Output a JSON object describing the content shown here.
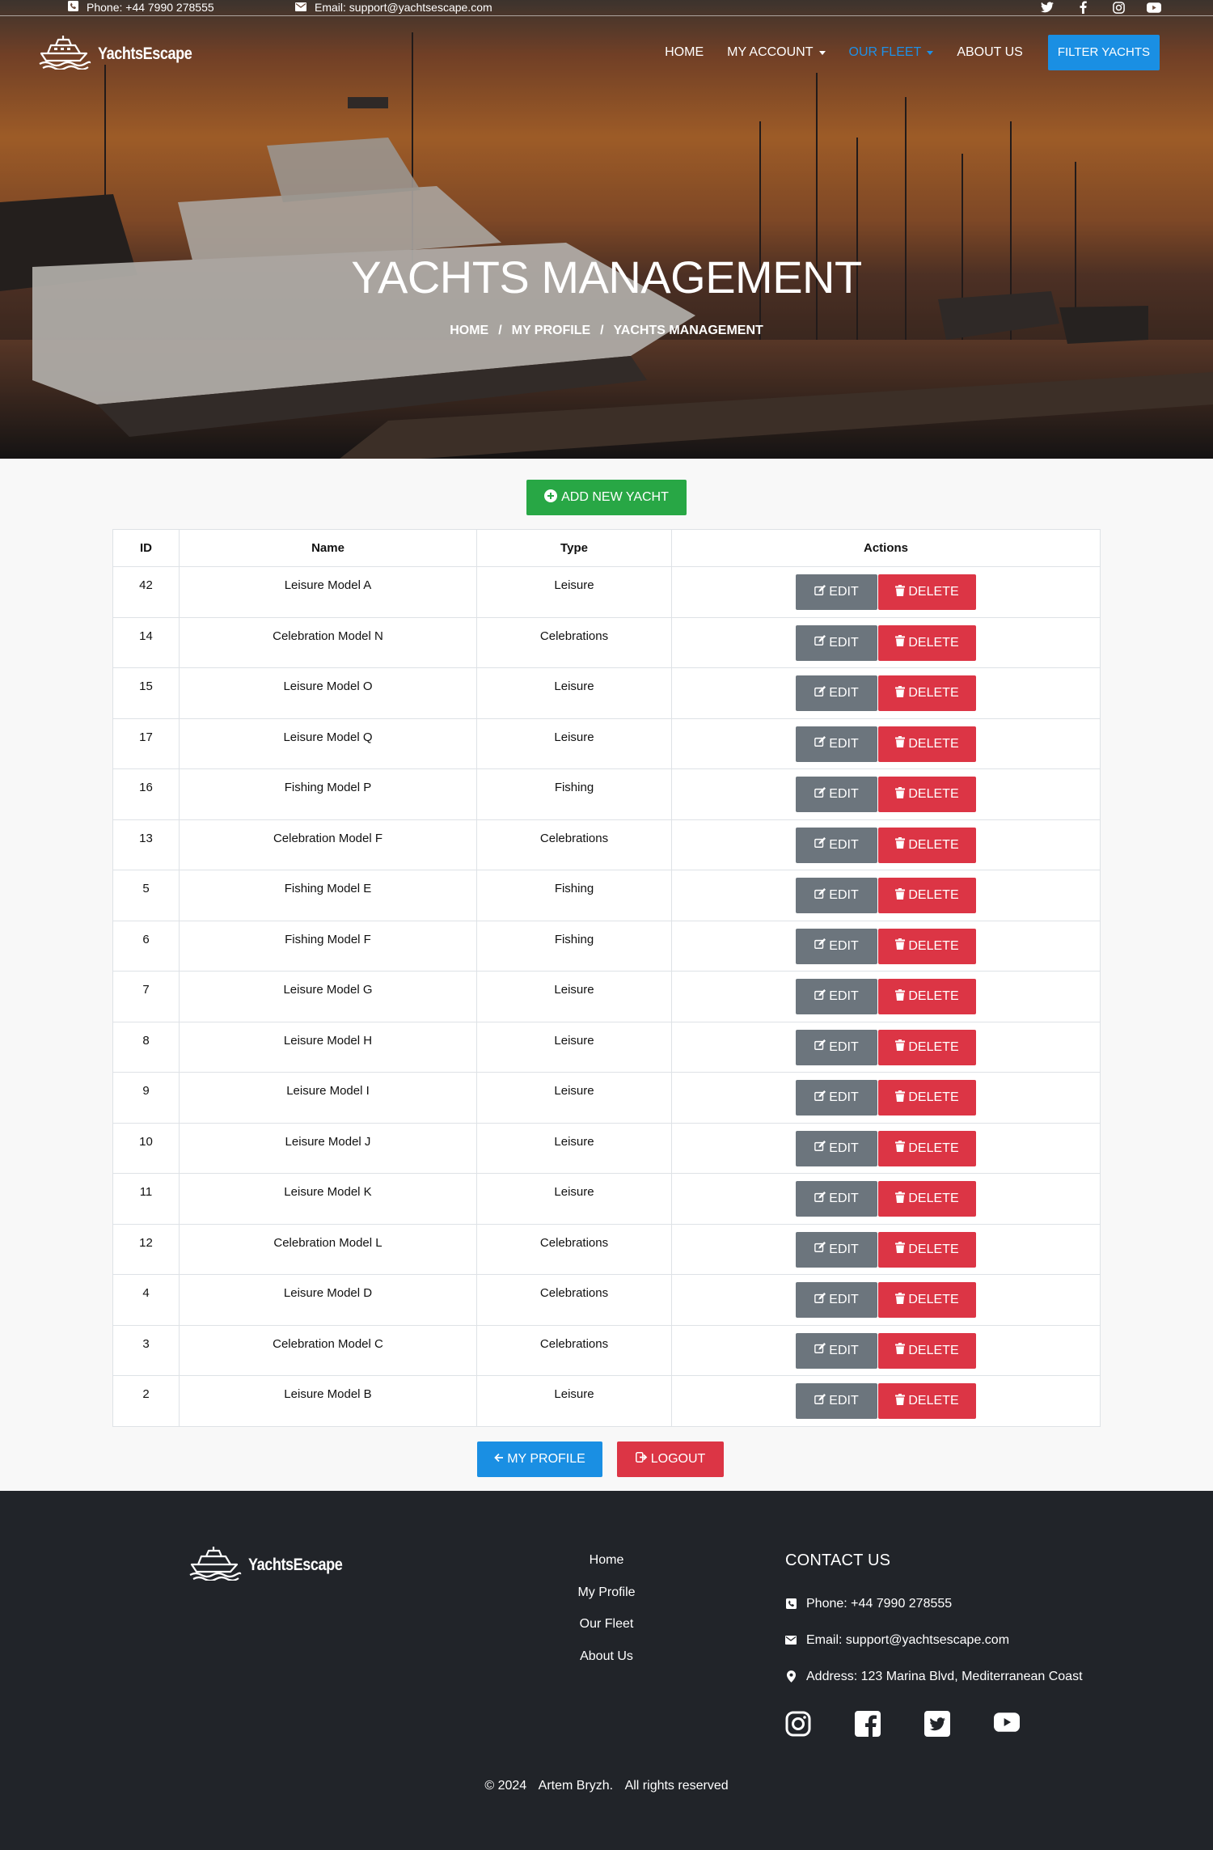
{
  "topbar": {
    "phone": "Phone: +44 7990 278555",
    "email": "Email: support@yachtsescape.com",
    "social_icons": [
      "twitter-icon",
      "facebook-icon",
      "instagram-icon",
      "youtube-icon"
    ]
  },
  "brand": {
    "name": "YachtsEscape"
  },
  "nav": {
    "home": "HOME",
    "my_account": "MY ACCOUNT",
    "our_fleet": "OUR FLEET",
    "about_us": "ABOUT US",
    "filter_yachts": "FILTER YACHTS"
  },
  "hero": {
    "title": "YACHTS MANAGEMENT",
    "breadcrumb": [
      "HOME",
      "MY PROFILE",
      "YACHTS MANAGEMENT"
    ],
    "separator": "/"
  },
  "main": {
    "add_button": "ADD NEW YACHT",
    "table": {
      "headers": [
        "ID",
        "Name",
        "Type",
        "Actions"
      ],
      "edit_label": "EDIT",
      "delete_label": "DELETE",
      "rows": [
        {
          "id": "42",
          "name": "Leisure Model A",
          "type": "Leisure"
        },
        {
          "id": "14",
          "name": "Celebration Model N",
          "type": "Celebrations"
        },
        {
          "id": "15",
          "name": "Leisure Model O",
          "type": "Leisure"
        },
        {
          "id": "17",
          "name": "Leisure Model Q",
          "type": "Leisure"
        },
        {
          "id": "16",
          "name": "Fishing Model P",
          "type": "Fishing"
        },
        {
          "id": "13",
          "name": "Celebration Model F",
          "type": "Celebrations"
        },
        {
          "id": "5",
          "name": "Fishing Model E",
          "type": "Fishing"
        },
        {
          "id": "6",
          "name": "Fishing Model F",
          "type": "Fishing"
        },
        {
          "id": "7",
          "name": "Leisure Model G",
          "type": "Leisure"
        },
        {
          "id": "8",
          "name": "Leisure Model H",
          "type": "Leisure"
        },
        {
          "id": "9",
          "name": "Leisure Model I",
          "type": "Leisure"
        },
        {
          "id": "10",
          "name": "Leisure Model J",
          "type": "Leisure"
        },
        {
          "id": "11",
          "name": "Leisure Model K",
          "type": "Leisure"
        },
        {
          "id": "12",
          "name": "Celebration Model L",
          "type": "Celebrations"
        },
        {
          "id": "4",
          "name": "Leisure Model D",
          "type": "Celebrations"
        },
        {
          "id": "3",
          "name": "Celebration Model C",
          "type": "Celebrations"
        },
        {
          "id": "2",
          "name": "Leisure Model B",
          "type": "Leisure"
        }
      ]
    },
    "my_profile_button": "MY PROFILE",
    "logout_button": "LOGOUT"
  },
  "footer": {
    "links": [
      "Home",
      "My Profile",
      "Our Fleet",
      "About Us"
    ],
    "contact_title": "CONTACT US",
    "phone": "Phone: +44 7990 278555",
    "email": "Email: support@yachtsescape.com",
    "address": "Address: 123 Marina Blvd, Mediterranean Coast",
    "social_icons": [
      "instagram-icon",
      "facebook-icon",
      "twitter-icon",
      "youtube-icon"
    ],
    "copyright": [
      "© 2024",
      "Artem Bryzh.",
      "All rights reserved"
    ]
  },
  "colors": {
    "primary": "#1a8fe3",
    "success": "#28a745",
    "danger": "#dc3545",
    "secondary": "#6c757d",
    "footer_bg": "#212429"
  }
}
